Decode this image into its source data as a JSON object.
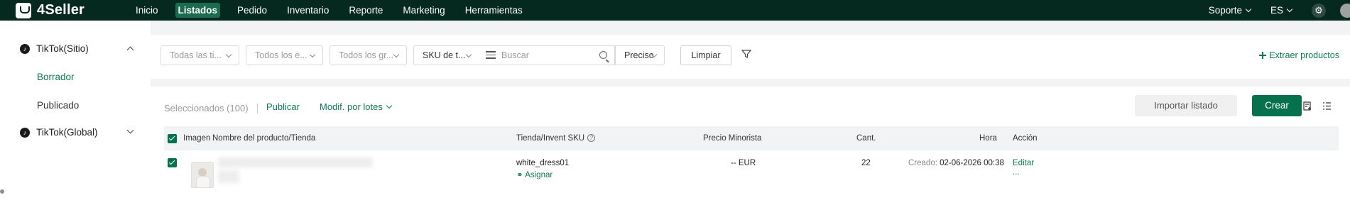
{
  "app": {
    "name": "4Seller"
  },
  "nav": {
    "items": [
      {
        "label": "Inicio"
      },
      {
        "label": "Listados"
      },
      {
        "label": "Pedido"
      },
      {
        "label": "Inventario"
      },
      {
        "label": "Reporte"
      },
      {
        "label": "Marketing"
      },
      {
        "label": "Herramientas"
      }
    ],
    "active": "Listados",
    "support": "Soporte",
    "language": "ES"
  },
  "sidebar": {
    "groups": [
      {
        "label": "TikTok(Sitio)",
        "expanded": true,
        "children": [
          {
            "label": "Borrador",
            "active": true
          },
          {
            "label": "Publicado"
          }
        ]
      },
      {
        "label": "TikTok(Global)",
        "expanded": false
      }
    ]
  },
  "filters": {
    "shops": "Todas las ti...",
    "status": "Todos los e...",
    "groups": "Todos los gr...",
    "sku_type": "SKU de t...",
    "search_placeholder": "Buscar",
    "price": "Preciso",
    "clear": "Limpiar",
    "extract": "Extraer productos"
  },
  "toolbar": {
    "selected": "Seleccionados (100)",
    "publish": "Publicar",
    "bulk_edit": "Modif. por lotes",
    "import": "Importar listado",
    "create": "Crear"
  },
  "table": {
    "headers": {
      "image": "Imagen",
      "name": "Nombre del producto/Tienda",
      "sku": "Tienda/Invent SKU",
      "price": "Precio Minorista",
      "qty": "Cant.",
      "time": "Hora",
      "action": "Acción"
    },
    "rows": [
      {
        "sku": "white_dress01",
        "assign": "Asignar",
        "price": "-- EUR",
        "qty": "22",
        "time_label": "Creado:",
        "time": "02-06-2026 00:38",
        "edit": "Editar",
        "more": "..."
      }
    ]
  },
  "colors": {
    "topbar": "#05291f",
    "accent": "#07704c"
  }
}
